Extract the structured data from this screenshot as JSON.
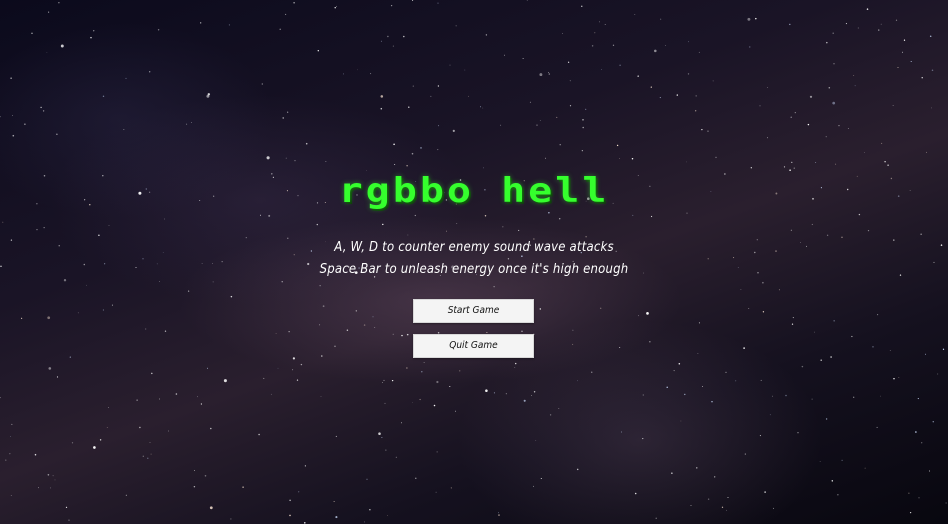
{
  "menu": {
    "title": "rgbbo hell",
    "instructions": [
      "A, W, D to counter enemy sound wave attacks",
      "Space Bar to unleash energy once it's high enough"
    ],
    "buttons": {
      "start": "Start Game",
      "quit": "Quit Game"
    }
  },
  "colors": {
    "title": "#35ff2d",
    "button_bg": "#f4f4f4",
    "button_text": "#111111",
    "text": "#ffffff"
  }
}
